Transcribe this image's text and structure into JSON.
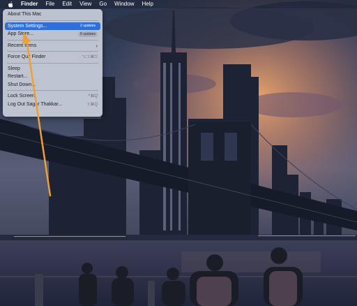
{
  "menubar": {
    "apple_icon": "apple-logo-icon",
    "items": [
      {
        "label": "Finder",
        "bold": true
      },
      {
        "label": "File"
      },
      {
        "label": "Edit"
      },
      {
        "label": "View"
      },
      {
        "label": "Go"
      },
      {
        "label": "Window"
      },
      {
        "label": "Help"
      }
    ]
  },
  "apple_menu": {
    "about": "About This Mac",
    "system_settings": {
      "label": "System Settings...",
      "badge": "2 updates"
    },
    "app_store": {
      "label": "App Store...",
      "badge": "8 updates"
    },
    "recent_items": {
      "label": "Recent Items",
      "submenu_icon": "chevron-right-icon"
    },
    "force_quit": {
      "label": "Force Quit Finder",
      "shortcut": "⌥⇧⌘⎋"
    },
    "sleep": "Sleep",
    "restart": "Restart...",
    "shut_down": "Shut Down...",
    "lock_screen": {
      "label": "Lock Screen",
      "shortcut": "^⌘Q"
    },
    "log_out": {
      "label": "Log Out Sagar Thakkar...",
      "shortcut": "⇧⌘Q"
    }
  },
  "colors": {
    "highlight": "#2f6fdc",
    "annotation_arrow": "#f0a030"
  }
}
